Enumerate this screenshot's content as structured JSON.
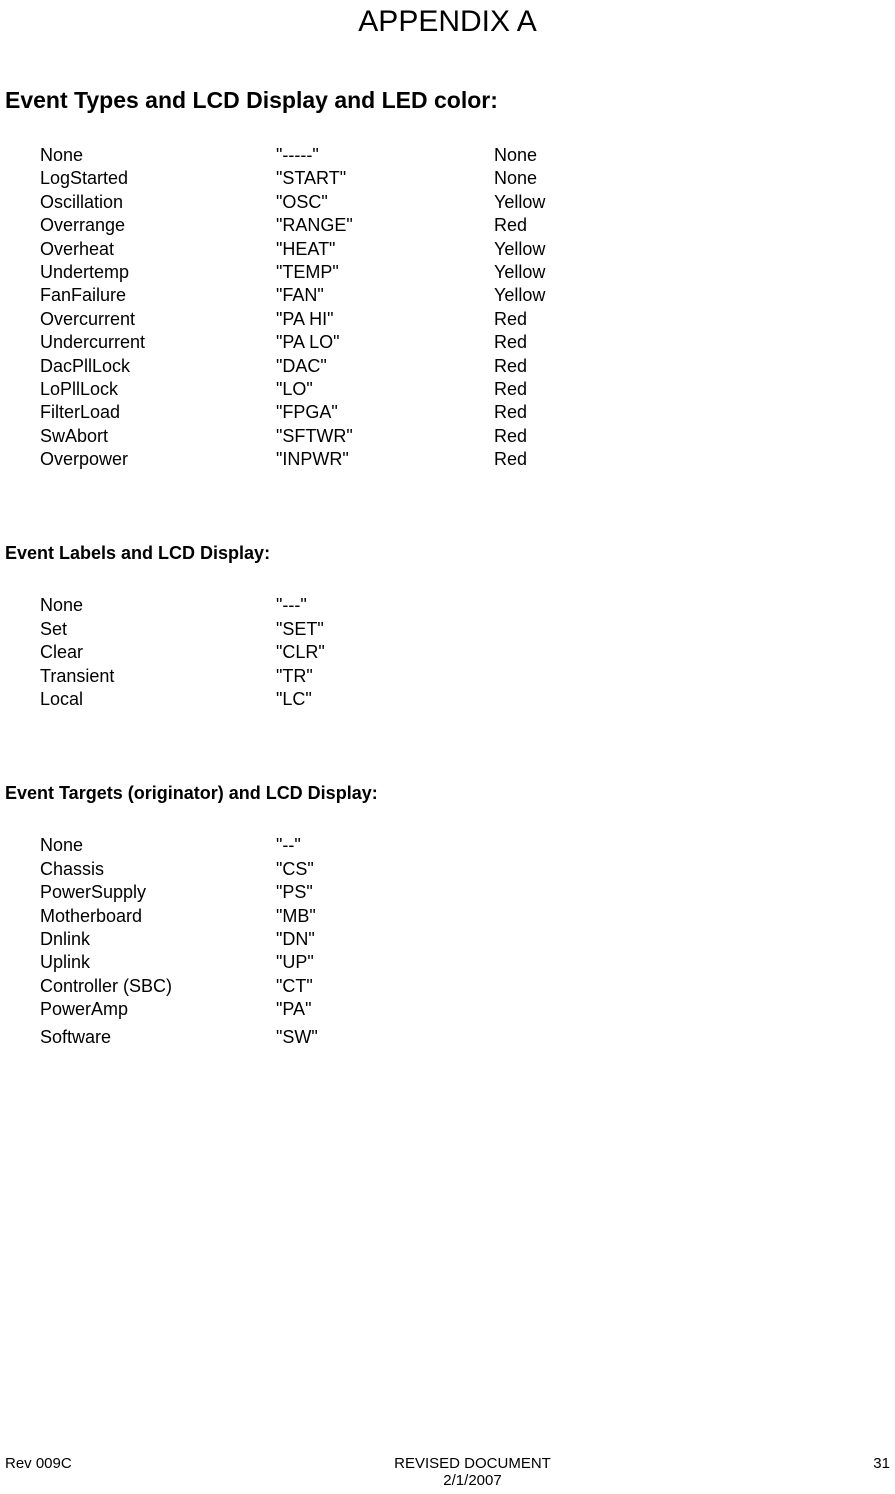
{
  "appendix_title": "APPENDIX A",
  "section1": {
    "title": "Event Types and LCD Display and LED color:",
    "rows": [
      {
        "type": "None",
        "lcd": "\"-----\"",
        "led": "None"
      },
      {
        "type": "LogStarted",
        "lcd": "\"START\"",
        "led": "None"
      },
      {
        "type": "Oscillation",
        "lcd": "\"OSC\"",
        "led": "Yellow"
      },
      {
        "type": "Overrange",
        "lcd": "\"RANGE\"",
        "led": "Red"
      },
      {
        "type": "Overheat",
        "lcd": "\"HEAT\"",
        "led": "Yellow"
      },
      {
        "type": "Undertemp",
        "lcd": "\"TEMP\"",
        "led": "Yellow"
      },
      {
        "type": "FanFailure",
        "lcd": "\"FAN\"",
        "led": "Yellow"
      },
      {
        "type": "Overcurrent",
        "lcd": "\"PA HI\"",
        "led": "Red"
      },
      {
        "type": "Undercurrent",
        "lcd": "\"PA LO\"",
        "led": "Red"
      },
      {
        "type": "DacPllLock",
        "lcd": "\"DAC\"",
        "led": "Red"
      },
      {
        "type": "LoPllLock",
        "lcd": "\"LO\"",
        "led": "Red"
      },
      {
        "type": "FilterLoad",
        "lcd": "\"FPGA\"",
        "led": "Red"
      },
      {
        "type": "SwAbort",
        "lcd": "\"SFTWR\"",
        "led": "Red"
      },
      {
        "type": "Overpower",
        "lcd": "\"INPWR\"",
        "led": "Red"
      }
    ]
  },
  "section2": {
    "title": "Event Labels and LCD Display:",
    "rows": [
      {
        "label": "None",
        "lcd": "\"---\""
      },
      {
        "label": "Set",
        "lcd": "\"SET\""
      },
      {
        "label": "Clear",
        "lcd": "\"CLR\""
      },
      {
        "label": "Transient",
        "lcd": "\"TR\""
      },
      {
        "label": "Local",
        "lcd": "\"LC\""
      }
    ]
  },
  "section3": {
    "title": "Event Targets (originator) and LCD Display:",
    "rows": [
      {
        "target": "None",
        "lcd": "\"--\""
      },
      {
        "target": "Chassis",
        "lcd": "\"CS\""
      },
      {
        "target": "PowerSupply",
        "lcd": "\"PS\""
      },
      {
        "target": "Motherboard",
        "lcd": "\"MB\""
      },
      {
        "target": "Dnlink",
        "lcd": "\"DN\""
      },
      {
        "target": "Uplink",
        "lcd": "\"UP\""
      },
      {
        "target": "Controller (SBC)",
        "lcd": " \"CT\""
      },
      {
        "target": "PowerAmp",
        "lcd": "\"PA\""
      },
      {
        "target": "Software",
        "lcd": "\"SW\""
      }
    ]
  },
  "footer": {
    "left": "Rev 009C",
    "center_top": "REVISED DOCUMENT",
    "center_bottom": "2/1/2007",
    "right": "31"
  }
}
